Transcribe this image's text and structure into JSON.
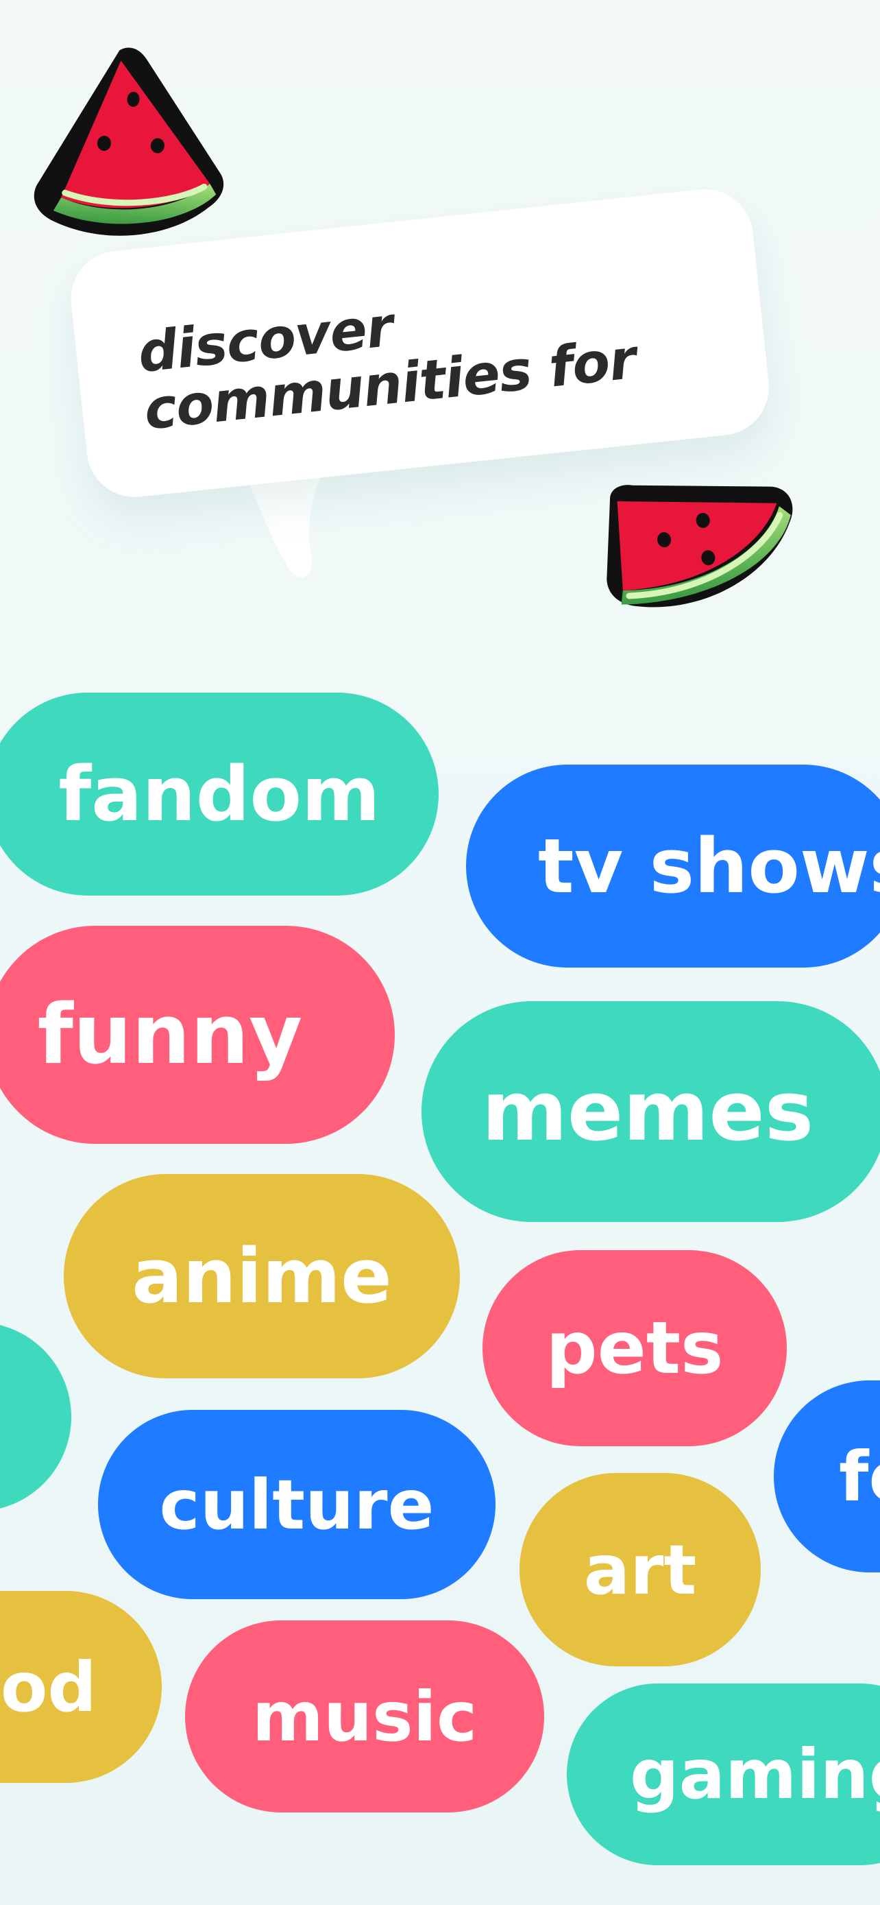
{
  "headline": {
    "line1": "discover",
    "line2": "communities for"
  },
  "colors": {
    "teal": "#3fd9bd",
    "blue": "#1f7bff",
    "pink": "#ff5f7b",
    "yellow": "#e6c03f",
    "background": "#eef8f8",
    "text_dark": "#2b2b2b"
  },
  "stickers": [
    "watermelon-slice-icon",
    "watermelon-slice-icon"
  ],
  "categories": {
    "fandom": "fandom",
    "tv_shows": "tv shows",
    "funny": "funny",
    "memes": "memes",
    "anime": "anime",
    "pets": "pets",
    "partial_left": "",
    "culture": "culture",
    "food_partial_right": "fo",
    "art": "art",
    "food_partial_left": "od",
    "music": "music",
    "gaming": "gaming"
  }
}
